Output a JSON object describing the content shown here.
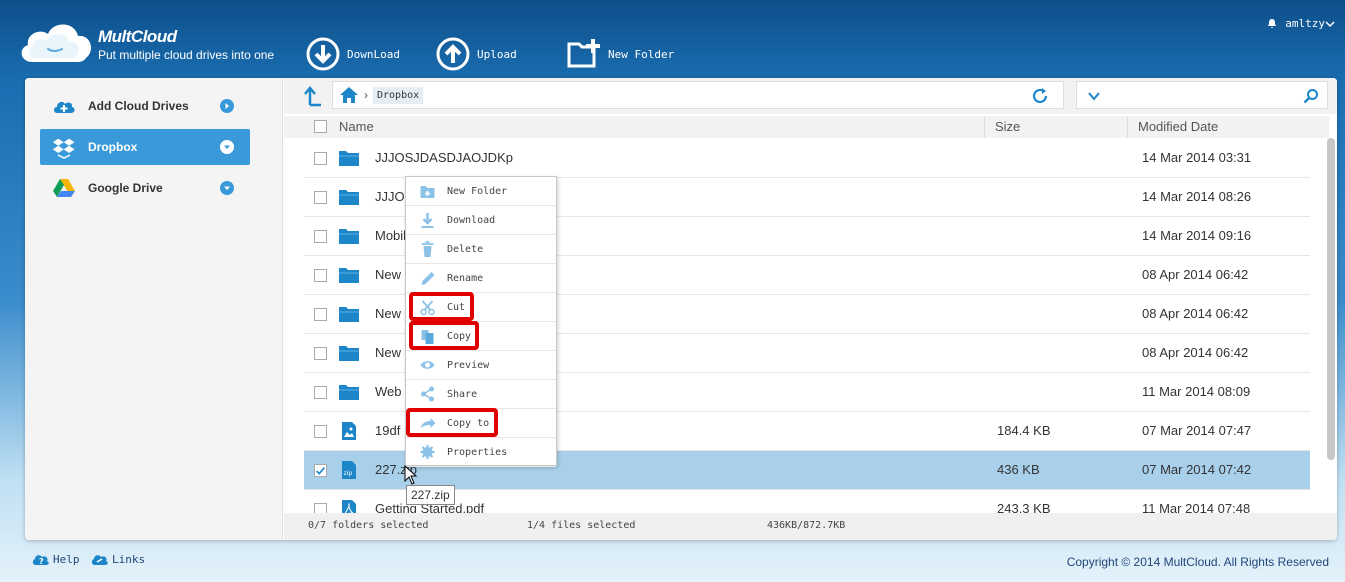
{
  "brand": {
    "title": "MultCloud",
    "subtitle": "Put multiple cloud drives into one"
  },
  "toolbar": {
    "download_label": "DownLoad",
    "upload_label": "Upload",
    "new_folder_label": "New Folder"
  },
  "user": {
    "name": "amltzy"
  },
  "sidebar": {
    "items": [
      {
        "label": "Add Cloud Drives",
        "icon": "add-cloud-icon"
      },
      {
        "label": "Dropbox",
        "icon": "dropbox-icon",
        "active": true
      },
      {
        "label": "Google Drive",
        "icon": "google-drive-icon"
      }
    ]
  },
  "path": {
    "crumb": "Dropbox"
  },
  "search": {
    "value": ""
  },
  "table": {
    "headers": {
      "name": "Name",
      "size": "Size",
      "modified": "Modified Date"
    },
    "rows": [
      {
        "name": "JJJOSJDASDJAOJDKp",
        "size": "",
        "date": "14 Mar 2014 03:31",
        "type": "folder"
      },
      {
        "name": "JJJOS",
        "size": "",
        "date": "14 Mar 2014 08:26",
        "type": "folder"
      },
      {
        "name": "Mobil",
        "size": "",
        "date": "14 Mar 2014 09:16",
        "type": "folder"
      },
      {
        "name": "New",
        "size": "",
        "date": "08 Apr 2014 06:42",
        "type": "folder"
      },
      {
        "name": "New",
        "size": "",
        "date": "08 Apr 2014 06:42",
        "type": "folder"
      },
      {
        "name": "New",
        "size": "",
        "date": "08 Apr 2014 06:42",
        "type": "folder"
      },
      {
        "name": "Web",
        "size": "",
        "date": "11 Mar 2014 08:09",
        "type": "folder"
      },
      {
        "name": "19df",
        "size": "184.4 KB",
        "date": "07 Mar 2014 07:47",
        "type": "image"
      },
      {
        "name": "227.zip",
        "size": "436 KB",
        "date": "07 Mar 2014 07:42",
        "type": "zip",
        "selected": true
      },
      {
        "name": "Getting Started.pdf",
        "size": "243.3 KB",
        "date": "11 Mar 2014 07:48",
        "type": "pdf"
      }
    ]
  },
  "context_menu": {
    "items": [
      {
        "label": "New Folder",
        "icon": "new-folder-icon"
      },
      {
        "label": "Download",
        "icon": "download-icon"
      },
      {
        "label": "Delete",
        "icon": "trash-icon"
      },
      {
        "label": "Rename",
        "icon": "pencil-icon"
      },
      {
        "label": "Cut",
        "icon": "scissors-icon",
        "highlighted": true
      },
      {
        "label": "Copy",
        "icon": "copy-icon",
        "highlighted": true
      },
      {
        "label": "Preview",
        "icon": "eye-icon"
      },
      {
        "label": "Share",
        "icon": "share-icon"
      },
      {
        "label": "Copy to",
        "icon": "copy-to-icon",
        "highlighted": true
      },
      {
        "label": "Properties",
        "icon": "gear-icon"
      }
    ]
  },
  "tooltip": "227.zip",
  "status": {
    "folders": "0/7 folders selected",
    "files": "1/4 files selected",
    "size": "436KB/872.7KB"
  },
  "footer": {
    "help": "Help",
    "links": "Links",
    "copyright": "Copyright © 2014 MultCloud. All Rights Reserved"
  },
  "colors": {
    "accent": "#3a9ad9",
    "selected_row": "#a9d0ea",
    "highlight_box": "#e00000",
    "folder": "#1c86c8"
  }
}
